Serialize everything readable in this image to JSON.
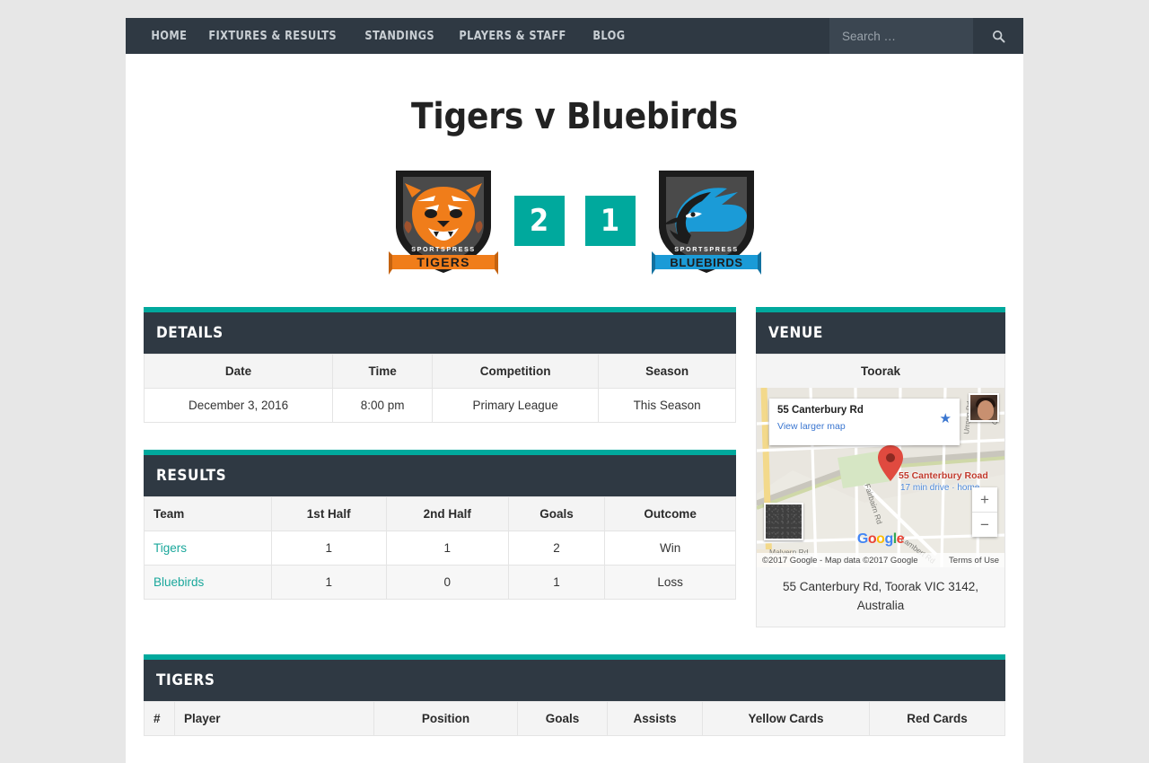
{
  "nav": {
    "items": [
      {
        "label": "HOME",
        "name": "nav-item-home"
      },
      {
        "label": "FIXTURES & RESULTS",
        "name": "nav-item-fixtures-results"
      },
      {
        "label": "STANDINGS",
        "name": "nav-item-standings"
      },
      {
        "label": "PLAYERS & STAFF",
        "name": "nav-item-players-staff"
      },
      {
        "label": "BLOG",
        "name": "nav-item-blog"
      }
    ],
    "search_placeholder": "Search …",
    "search_value": "",
    "search_icon": "search-icon"
  },
  "page": {
    "title": "Tigers v Bluebirds"
  },
  "scoreboard": {
    "home": {
      "team": "Tigers",
      "score": "2",
      "crest_name": "tigers-crest",
      "crest_banner": "TIGERS",
      "crest_arc": "SPORTSPRESS",
      "primary_color": "#f07d1a",
      "dark_color": "#1c1c1c"
    },
    "away": {
      "team": "Bluebirds",
      "score": "1",
      "crest_name": "bluebirds-crest",
      "crest_banner": "BLUEBIRDS",
      "crest_arc": "SPORTSPRESS",
      "primary_color": "#1b9bd7",
      "dark_color": "#1c1c1c"
    }
  },
  "details": {
    "heading": "DETAILS",
    "columns": [
      "Date",
      "Time",
      "Competition",
      "Season"
    ],
    "row": [
      "December 3, 2016",
      "8:00 pm",
      "Primary League",
      "This Season"
    ]
  },
  "results": {
    "heading": "RESULTS",
    "columns": [
      "Team",
      "1st Half",
      "2nd Half",
      "Goals",
      "Outcome"
    ],
    "rows": [
      {
        "team": "Tigers",
        "first_half": "1",
        "second_half": "1",
        "goals": "2",
        "outcome": "Win"
      },
      {
        "team": "Bluebirds",
        "first_half": "1",
        "second_half": "0",
        "goals": "1",
        "outcome": "Loss"
      }
    ]
  },
  "venue": {
    "heading": "VENUE",
    "name": "Toorak",
    "address": "55 Canterbury Rd, Toorak VIC 3142, Australia",
    "map": {
      "card_title": "55 Canterbury Rd",
      "card_link": "View larger map",
      "marker_label": "55 Canterbury Road",
      "marker_sublabel": "17 min drive · home",
      "street_labels": [
        "Fairbairn Rd",
        "Lambert Rd",
        "Malvern Rd",
        "Urrong Rd"
      ],
      "logo_letters": [
        "G",
        "o",
        "o",
        "g",
        "l",
        "e"
      ],
      "zoom_in": "+",
      "zoom_out": "−",
      "attribution": "©2017 Google - Map data ©2017 Google",
      "terms": "Terms of Use"
    }
  },
  "roster": {
    "heading": "TIGERS",
    "columns": [
      "#",
      "Player",
      "Position",
      "Goals",
      "Assists",
      "Yellow Cards",
      "Red Cards"
    ]
  },
  "colors": {
    "accent": "#00a99d",
    "header_dark": "#2f3943",
    "link": "#1aa79b",
    "page_bg": "#e7e7e7"
  }
}
